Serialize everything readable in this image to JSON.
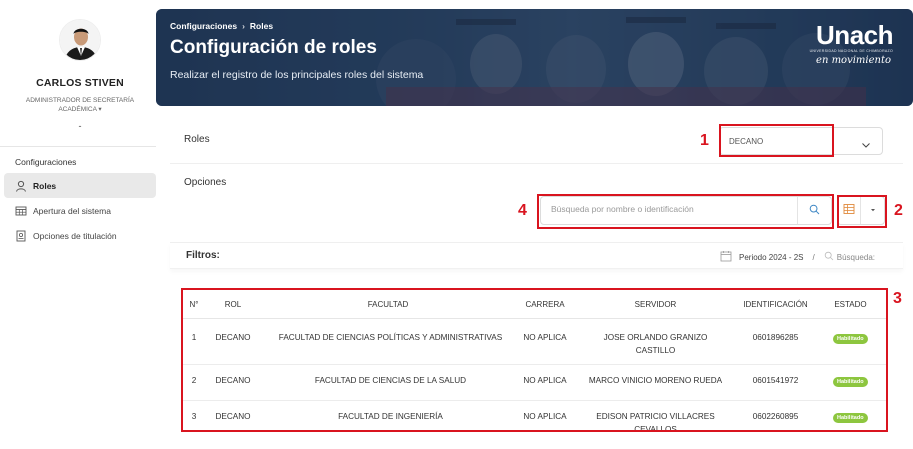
{
  "user": {
    "name": "CARLOS STIVEN",
    "role": "ADMINISTRADOR DE SECRETARÍA ACADÉMICA",
    "caret": "▾",
    "extra": "-"
  },
  "sidebar": {
    "section": "Configuraciones",
    "items": [
      {
        "label": "Roles",
        "icon": "user-icon",
        "active": true
      },
      {
        "label": "Apertura del sistema",
        "icon": "calendar-grid-icon",
        "active": false
      },
      {
        "label": "Opciones de titulación",
        "icon": "document-icon",
        "active": false
      }
    ]
  },
  "banner": {
    "crumbs": [
      "Configuraciones",
      "Roles"
    ],
    "crumb_sep": "›",
    "title": "Configuración de roles",
    "subtitle": "Realizar el registro de los principales roles del sistema",
    "brand_name": "Unach",
    "brand_small": "UNIVERSIDAD NACIONAL DE CHIMBORAZO",
    "brand_tag": "en movimiento"
  },
  "roles": {
    "label": "Roles",
    "selected": "DECANO"
  },
  "options": {
    "label": "Opciones",
    "search_placeholder": "Búsqueda por nombre o identificación"
  },
  "filters": {
    "label": "Filtros:",
    "period": "Periodo 2024 - 2S",
    "slash": "/",
    "search_label": "Búsqueda:"
  },
  "table": {
    "headers": [
      "N°",
      "ROL",
      "FACULTAD",
      "CARRERA",
      "SERVIDOR",
      "IDENTIFICACIÓN",
      "ESTADO"
    ],
    "rows": [
      {
        "n": "1",
        "rol": "DECANO",
        "facultad": "FACULTAD DE CIENCIAS POLÍTICAS Y ADMINISTRATIVAS",
        "carrera": "NO APLICA",
        "servidor": "JOSE ORLANDO GRANIZO CASTILLO",
        "id": "0601896285",
        "estado": "Habilitado"
      },
      {
        "n": "2",
        "rol": "DECANO",
        "facultad": "FACULTAD DE CIENCIAS DE LA SALUD",
        "carrera": "NO APLICA",
        "servidor": "MARCO VINICIO MORENO RUEDA",
        "id": "0601541972",
        "estado": "Habilitado"
      },
      {
        "n": "3",
        "rol": "DECANO",
        "facultad": "FACULTAD DE INGENIERÍA",
        "carrera": "NO APLICA",
        "servidor": "EDISON PATRICIO VILLACRES CEVALLOS",
        "id": "0602260895",
        "estado": "Habilitado"
      }
    ]
  },
  "annotations": [
    "1",
    "2",
    "3",
    "4"
  ],
  "colors": {
    "accent_red": "#d9141f",
    "badge_green": "#8dc63f",
    "banner_navy": "#2b4664"
  }
}
